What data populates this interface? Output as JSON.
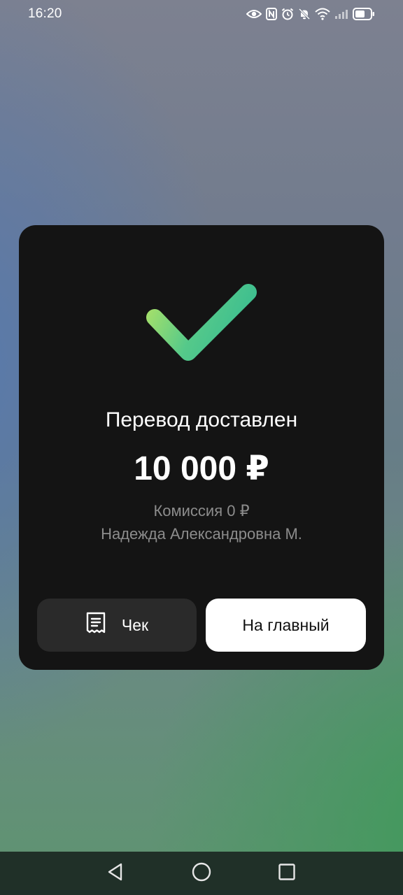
{
  "status_bar": {
    "time": "16:20",
    "icons": [
      "eye-icon",
      "nfc-icon",
      "alarm-icon",
      "mute-icon",
      "wifi-icon",
      "signal-icon",
      "battery-icon"
    ]
  },
  "result": {
    "title": "Перевод доставлен",
    "amount": "10 000 ₽",
    "fee": "Комиссия 0 ₽",
    "recipient": "Надежда Александровна М."
  },
  "actions": {
    "receipt_label": "Чек",
    "home_label": "На главный"
  },
  "nav": {
    "items": [
      "back",
      "home",
      "recents"
    ]
  },
  "colors": {
    "card": "#141414",
    "check_start": "#a6e06a",
    "check_end": "#3fbf8f",
    "muted_text": "#8c8c8c",
    "secondary_button": "#2a2a2a",
    "primary_button": "#ffffff"
  }
}
